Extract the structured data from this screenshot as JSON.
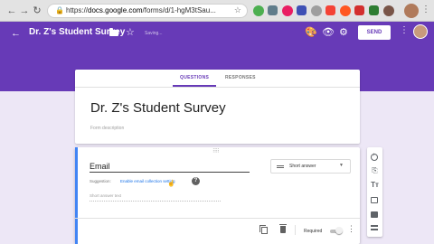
{
  "browser": {
    "url_scheme": "https://",
    "url_host": "docs.google.com",
    "url_path": "/forms/d/1-hgM3tSau..."
  },
  "header": {
    "back_icon": "arrow-left-icon",
    "title": "Dr. Z's Student Survey",
    "status": "Saving...",
    "send_label": "SEND",
    "accent_color": "#673ab7"
  },
  "tabs": [
    {
      "label": "QUESTIONS",
      "active": true
    },
    {
      "label": "RESPONSES",
      "active": false
    }
  ],
  "form": {
    "title": "Dr. Z's Student Survey",
    "description_placeholder": "Form description"
  },
  "question": {
    "title": "Email",
    "type": "Short answer",
    "suggestion_prefix": "Suggestion:",
    "suggestion_link": "Enable email collection setting",
    "answer_placeholder": "Short answer text",
    "required_label": "Required",
    "required": false
  },
  "side_toolbar": [
    "add-question-icon",
    "import-questions-icon",
    "add-title-icon",
    "add-image-icon",
    "add-video-icon",
    "add-section-icon"
  ]
}
